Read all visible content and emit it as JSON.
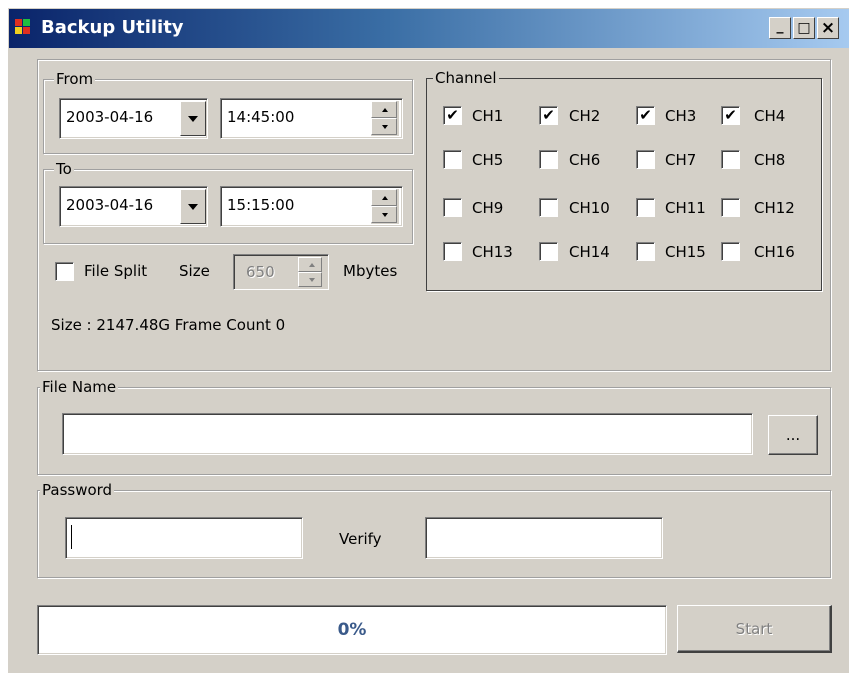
{
  "window": {
    "title": "Backup Utility",
    "minimize_glyph": "_",
    "maximize_glyph": "□",
    "close_glyph": "×"
  },
  "from": {
    "label": "From",
    "date": "2003-04-16",
    "time": "14:45:00"
  },
  "to": {
    "label": "To",
    "date": "2003-04-16",
    "time": "15:15:00"
  },
  "channel": {
    "label": "Channel",
    "items": [
      {
        "label": "CH1",
        "checked": true
      },
      {
        "label": "CH2",
        "checked": true
      },
      {
        "label": "CH3",
        "checked": true
      },
      {
        "label": "CH4",
        "checked": true
      },
      {
        "label": "CH5",
        "checked": false
      },
      {
        "label": "CH6",
        "checked": false
      },
      {
        "label": "CH7",
        "checked": false
      },
      {
        "label": "CH8",
        "checked": false
      },
      {
        "label": "CH9",
        "checked": false
      },
      {
        "label": "CH10",
        "checked": false
      },
      {
        "label": "CH11",
        "checked": false
      },
      {
        "label": "CH12",
        "checked": false
      },
      {
        "label": "CH13",
        "checked": false
      },
      {
        "label": "CH14",
        "checked": false
      },
      {
        "label": "CH15",
        "checked": false
      },
      {
        "label": "CH16",
        "checked": false
      }
    ]
  },
  "split": {
    "label": "File Split",
    "checked": false,
    "size_label": "Size",
    "size_value": "650",
    "unit": "Mbytes"
  },
  "info": "Size : 2147.48G Frame Count 0",
  "file_name": {
    "label": "File Name",
    "value": "",
    "browse_label": "..."
  },
  "password": {
    "label": "Password",
    "value": "",
    "verify_label": "Verify",
    "verify_value": ""
  },
  "progress": {
    "text": "0%",
    "value": 0
  },
  "start_label": "Start",
  "colors": {
    "title_start": "#0a246a",
    "title_end": "#a6caf0",
    "face": "#d4d0c8",
    "progress_text": "#3a5a8a"
  }
}
